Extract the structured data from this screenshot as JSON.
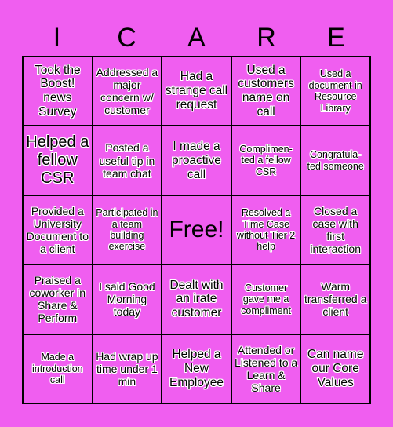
{
  "card": {
    "background_color": "#F05EF0",
    "header_letters": [
      "I",
      "C",
      "A",
      "R",
      "E"
    ],
    "cells": [
      [
        "Took the Boost! news Survey",
        "Addressed a major concern w/ customer",
        "Had a strange call request",
        "Used a customers name on call",
        "Used a document in Resource Library"
      ],
      [
        "Helped a fellow CSR",
        "Posted a useful tip in team chat",
        "I made a proactive call",
        "Complimen-ted a fellow CSR",
        "Congratula-ted someone"
      ],
      [
        "Provided a University Document to a client",
        "Participated in a team building exercise",
        "Free!",
        "Resolved a Time Case without Tier 2 help",
        "Closed a case with first interaction"
      ],
      [
        "Praised a coworker in Share & Perform",
        "I said Good Morning today",
        "Dealt with an irate customer",
        "Customer gave me a compliment",
        "Warm transferred a client"
      ],
      [
        "Made a introduction call",
        "Had wrap up time under 1 min",
        "Helped a New Employee",
        "Attended or Listened to a Learn & Share",
        "Can name our Core Values"
      ]
    ]
  }
}
